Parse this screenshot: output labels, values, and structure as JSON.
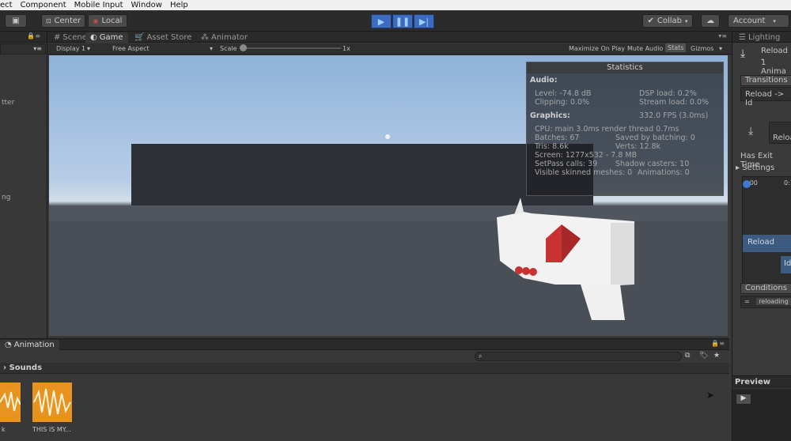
{
  "menubar": [
    "ect",
    "Component",
    "Mobile Input",
    "Window",
    "Help"
  ],
  "toolbar": {
    "pivot": "Center",
    "space": "Local",
    "collab": "Collab",
    "account": "Account"
  },
  "tabs": {
    "scene": "Scene",
    "game": "Game",
    "asset_store": "Asset Store",
    "animator": "Animator",
    "lighting": "Lighting"
  },
  "game_bar": {
    "display": "Display 1",
    "aspect": "Free Aspect",
    "scale_label": "Scale",
    "scale_value": "1x",
    "maximize": "Maximize On Play",
    "mute": "Mute Audio",
    "stats": "Stats",
    "gizmos": "Gizmos"
  },
  "left_panel": {
    "text1": "tter",
    "text2": "ng"
  },
  "statistics": {
    "title": "Statistics",
    "audio_header": "Audio:",
    "level": "Level: -74.8 dB",
    "dsp_load": "DSP load: 0.2%",
    "clipping": "Clipping: 0.0%",
    "stream_load": "Stream load: 0.0%",
    "graphics_header": "Graphics:",
    "fps": "332.0 FPS (3.0ms)",
    "cpu": "CPU: main 3.0ms  render thread 0.7ms",
    "batches": "Batches: 67",
    "saved_batching": "Saved by batching: 0",
    "tris": "Tris: 8.6k",
    "verts": "Verts: 12.8k",
    "screen": "Screen: 1277x532 - 7.8 MB",
    "setpass": "SetPass calls: 39",
    "shadow_casters": "Shadow casters: 10",
    "skinned": "Visible skinned meshes: 0",
    "animations": "Animations: 0"
  },
  "right_panel": {
    "reload_title": "Reload -",
    "animation_count": "1 Anima",
    "transitions": "Transitions",
    "transition_item": "Reload -> Id",
    "reload_label": "Reloa",
    "has_exit_time": "Has Exit Time",
    "settings": "Settings",
    "timeline_start": ":00",
    "timeline_end": "0:1",
    "track_reload": "Reload",
    "track_idle": "Id",
    "conditions": "Conditions",
    "condition_param": "reloading",
    "preview": "Preview"
  },
  "bottom": {
    "tab_animation": "Animation",
    "breadcrumb": "Sounds",
    "asset1_label": "k",
    "asset2_label": "THIS IS MY..."
  }
}
